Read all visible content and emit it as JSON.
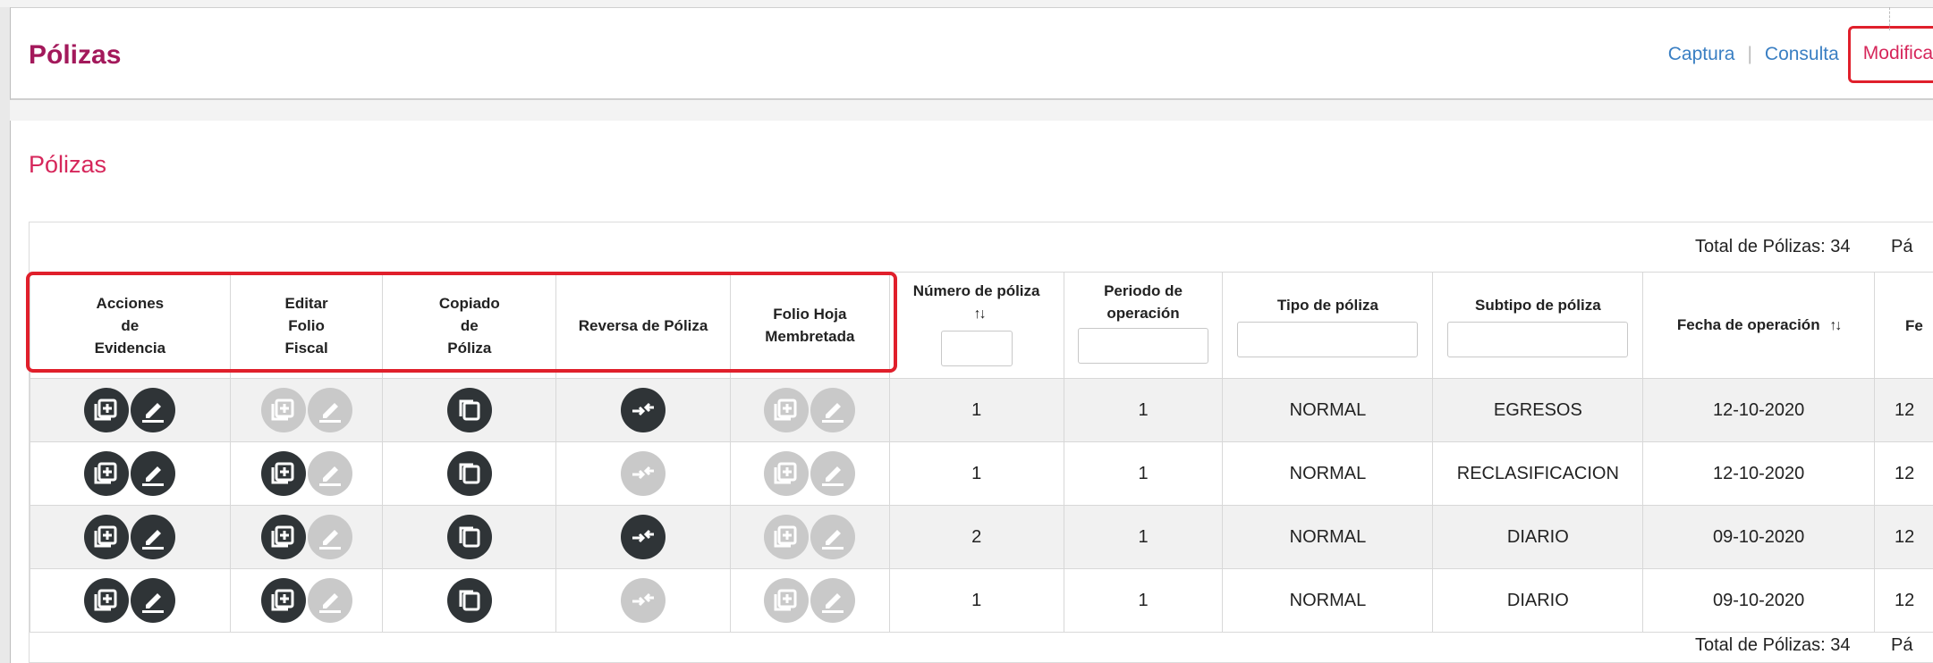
{
  "header": {
    "title": "Pólizas",
    "nav": [
      {
        "label": "Captura"
      },
      {
        "label": "Consulta"
      },
      {
        "label": "Modifica"
      }
    ],
    "separator": "|"
  },
  "section_title": "Pólizas",
  "totals_top": {
    "label": "Total de Pólizas: 34",
    "page_label": "Pá"
  },
  "totals_bottom": {
    "label": "Total de Pólizas: 34",
    "page_label": "Pá"
  },
  "columns": [
    {
      "label": "Acciones\nde\nEvidencia"
    },
    {
      "label": "Editar\nFolio\nFiscal"
    },
    {
      "label": "Copiado\nde\nPóliza"
    },
    {
      "label": "Reversa de Póliza"
    },
    {
      "label": "Folio Hoja\nMembretada"
    },
    {
      "label": "Número de póliza"
    },
    {
      "label": "Periodo de\noperación"
    },
    {
      "label": "Tipo de póliza"
    },
    {
      "label": "Subtipo de póliza"
    },
    {
      "label": "Fecha de operación"
    },
    {
      "label": "Fe"
    }
  ],
  "sort_icon": "sort-arrows-icon",
  "rows": [
    {
      "folio_fiscal_enabled": false,
      "reversa_enabled": true,
      "numero": "1",
      "periodo": "1",
      "tipo": "NORMAL",
      "subtipo": "EGRESOS",
      "fecha": "12-10-2020",
      "fecha2": "12"
    },
    {
      "folio_fiscal_enabled": true,
      "reversa_enabled": false,
      "numero": "1",
      "periodo": "1",
      "tipo": "NORMAL",
      "subtipo": "RECLASIFICACION",
      "fecha": "12-10-2020",
      "fecha2": "12"
    },
    {
      "folio_fiscal_enabled": true,
      "reversa_enabled": true,
      "numero": "2",
      "periodo": "1",
      "tipo": "NORMAL",
      "subtipo": "DIARIO",
      "fecha": "09-10-2020",
      "fecha2": "12"
    },
    {
      "folio_fiscal_enabled": true,
      "reversa_enabled": false,
      "numero": "1",
      "periodo": "1",
      "tipo": "NORMAL",
      "subtipo": "DIARIO",
      "fecha": "09-10-2020",
      "fecha2": "12"
    }
  ],
  "colors": {
    "brand_title": "#a3195b",
    "accent_pink": "#d6275b",
    "link_blue": "#3a7fc3",
    "highlight_red": "#e01f2b",
    "icon_dark": "#2f3437",
    "icon_disabled": "#c9c9c9"
  }
}
